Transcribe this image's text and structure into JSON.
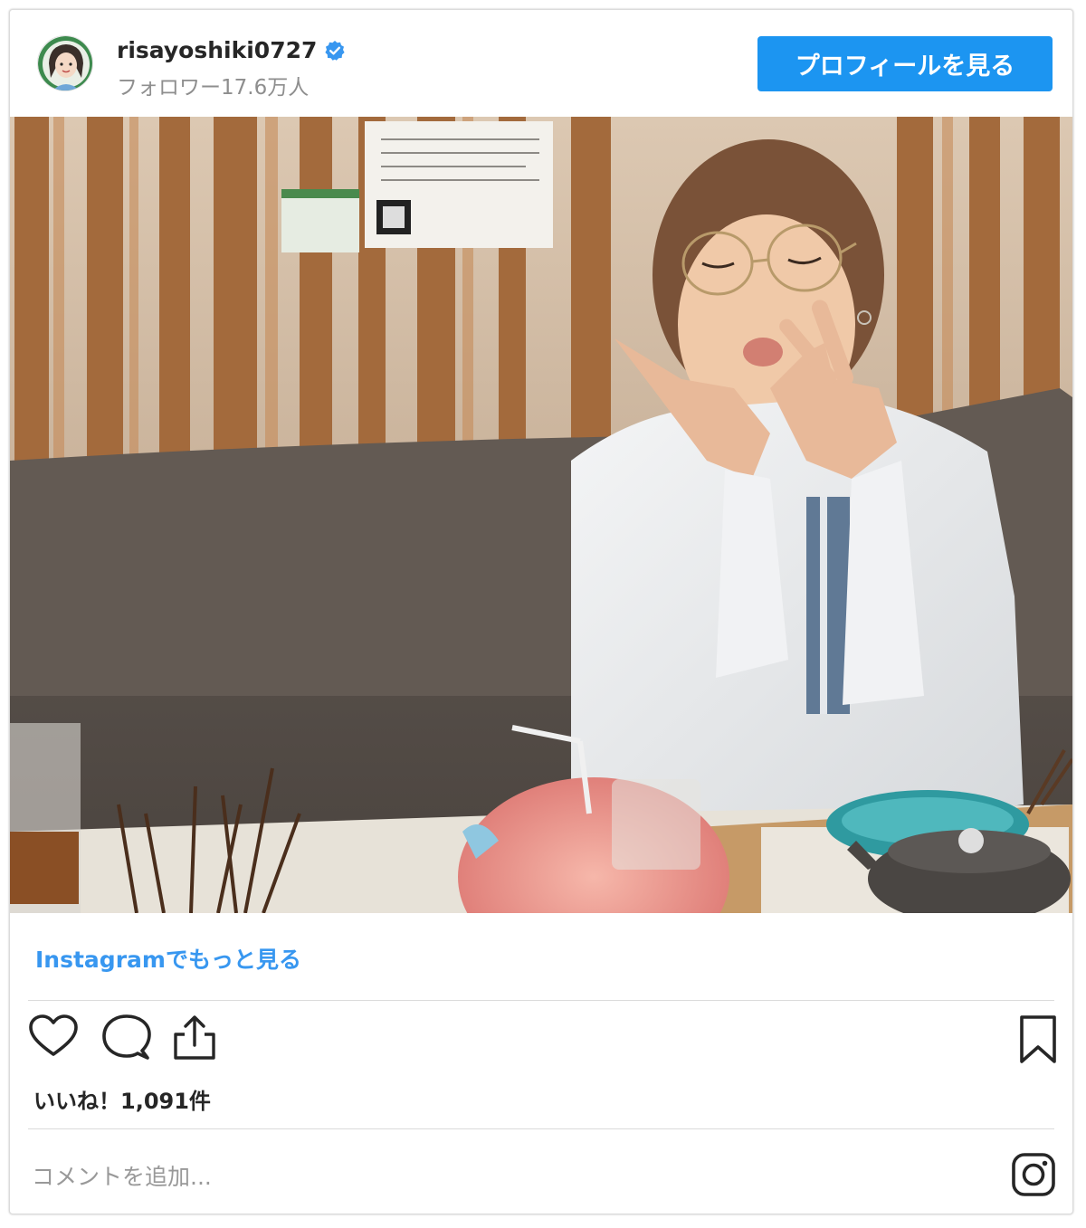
{
  "header": {
    "username": "risayoshiki0727",
    "followers": "フォロワー17.6万人",
    "profile_button": "プロフィールを見る"
  },
  "post": {
    "more_link": "Instagramでもっと見る",
    "likes": "いいね！1,091件",
    "comment_placeholder": "コメントを追加..."
  },
  "icons": [
    "verified-badge-icon",
    "heart-icon",
    "comment-icon",
    "share-icon",
    "bookmark-icon",
    "instagram-icon"
  ],
  "colors": {
    "button": "#1c95f1",
    "link": "#3897f0",
    "verified": "#3897f0",
    "muted": "#8e8e8e"
  }
}
